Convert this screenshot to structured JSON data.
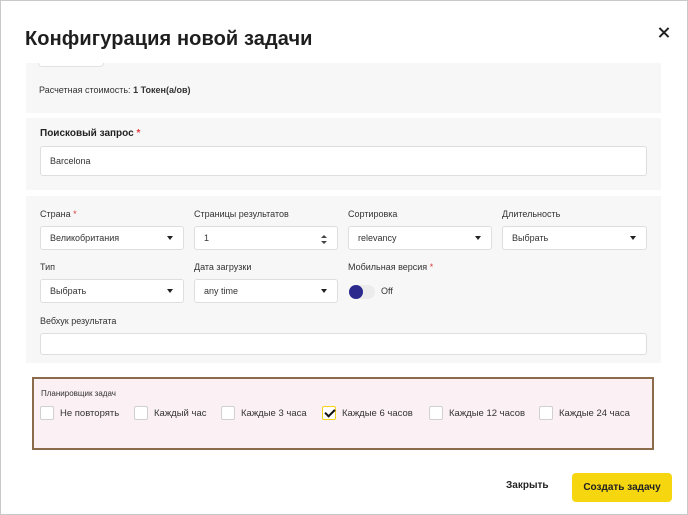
{
  "dialog": {
    "title": "Конфигурация новой задачи"
  },
  "cost": {
    "label": "Расчетная стоимость:",
    "value": "1 Токен(а/ов)"
  },
  "query": {
    "label": "Поисковый запрос",
    "required_mark": "*",
    "value": "Barcelona"
  },
  "params": {
    "country": {
      "label": "Страна",
      "required_mark": "*",
      "value": "Великобритания"
    },
    "pages": {
      "label": "Страницы результатов",
      "value": "1"
    },
    "sort": {
      "label": "Сортировка",
      "value": "relevancy"
    },
    "duration": {
      "label": "Длительность",
      "value": "Выбрать"
    },
    "type": {
      "label": "Тип",
      "value": "Выбрать"
    },
    "upload_date": {
      "label": "Дата загрузки",
      "value": "any time"
    },
    "mobile": {
      "label": "Мобильная версия",
      "required_mark": "*",
      "state_text": "Off",
      "on": false
    },
    "webhook": {
      "label": "Вебхук результата",
      "value": ""
    }
  },
  "scheduler": {
    "label": "Планировщик задач",
    "options": [
      {
        "label": "Не повторять",
        "checked": false
      },
      {
        "label": "Каждый час",
        "checked": false
      },
      {
        "label": "Каждые 3 часа",
        "checked": false
      },
      {
        "label": "Каждые 6 часов",
        "checked": true
      },
      {
        "label": "Каждые 12 часов",
        "checked": false
      },
      {
        "label": "Каждые 24 часа",
        "checked": false
      }
    ]
  },
  "footer": {
    "close_label": "Закрыть",
    "create_label": "Создать задачу"
  },
  "colors": {
    "accent": "#f5d60f",
    "toggle_knob": "#2c2a8c",
    "required": "#e03b3b",
    "highlight_border": "#8b6b4a"
  }
}
